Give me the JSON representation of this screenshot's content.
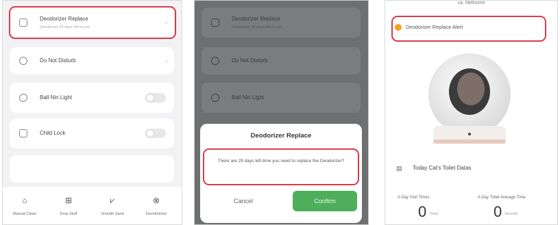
{
  "screen1": {
    "deodorizer": {
      "title": "Deodorizer Replace",
      "subtitle": "Deodorizer 29 days left to use"
    },
    "do_not_disturb": "Do Not Disturb",
    "ball_light": "Ball Nin Light",
    "child_lock": "Child Lock",
    "tabs": [
      {
        "label": "Manual Clean",
        "icon": "trash-icon"
      },
      {
        "label": "Drop Stuff",
        "icon": "clear-icon"
      },
      {
        "label": "Smooth Sand",
        "icon": "smooth-icon"
      },
      {
        "label": "Dechlorinize",
        "icon": "settings-icon"
      }
    ]
  },
  "screen2": {
    "deodorizer": {
      "title": "Deodorizer Replace",
      "subtitle": "Deodorizer 29 days left to use"
    },
    "do_not_disturb": "Do Not Disturb",
    "ball_light": "Ball Nin Light",
    "dialog": {
      "title": "Deodorizer Replace",
      "message": "There are 29 days left-time you need to replace the Deodorizer?",
      "cancel": "Cancel",
      "confirm": "Confirm"
    }
  },
  "screen3": {
    "header": "ca. Nethome",
    "alert": "Deodorizer Replace Alert",
    "today_label": "Today Cat's Toilet Datas",
    "stats": [
      {
        "label": "A Day Visit Times",
        "value": "0",
        "unit": "Times"
      },
      {
        "label": "A Day Toilet Average Time",
        "value": "0",
        "unit": "Seconds"
      }
    ]
  },
  "colors": {
    "highlight": "#d93a4a",
    "confirm": "#4fae5c",
    "alert_dot": "#f4a31d"
  }
}
